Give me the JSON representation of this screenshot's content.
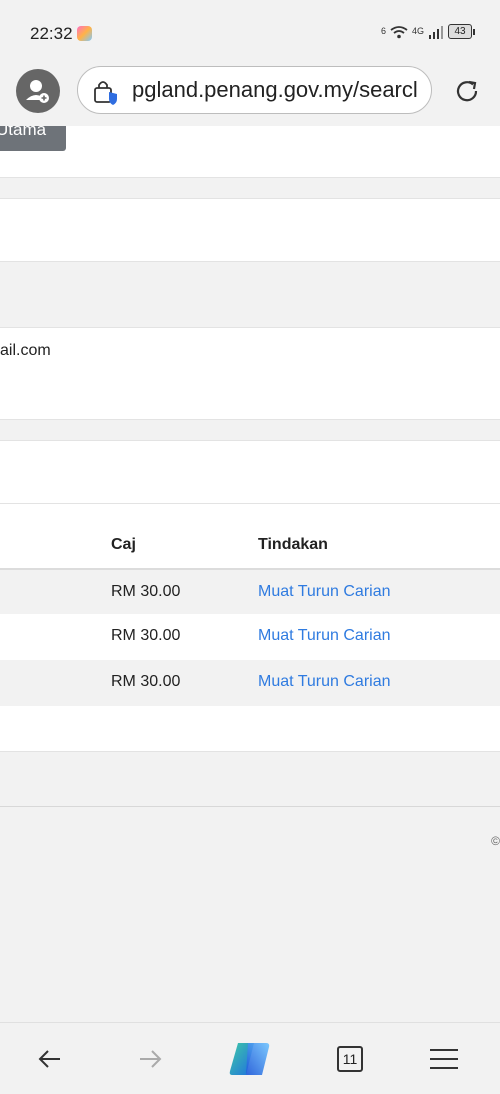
{
  "status_bar": {
    "time": "22:32",
    "network_label": "4G",
    "sim_label": "6",
    "battery": "43"
  },
  "browser": {
    "url": "pgland.penang.gov.my/searcl",
    "tab_count": "11"
  },
  "page": {
    "button_partial": "Utama",
    "email_fragment": "ail.com",
    "table": {
      "headers": [
        "Caj",
        "Tindakan"
      ],
      "rows": [
        {
          "caj": "RM 30.00",
          "action": "Muat Turun Carian"
        },
        {
          "caj": "RM 30.00",
          "action": "Muat Turun Carian"
        },
        {
          "caj": "RM 30.00",
          "action": "Muat Turun Carian"
        }
      ]
    },
    "copyright_fragment": "©"
  },
  "colors": {
    "link": "#2f7be0",
    "button_gray": "#6e7379",
    "background": "#f2f2f2"
  }
}
